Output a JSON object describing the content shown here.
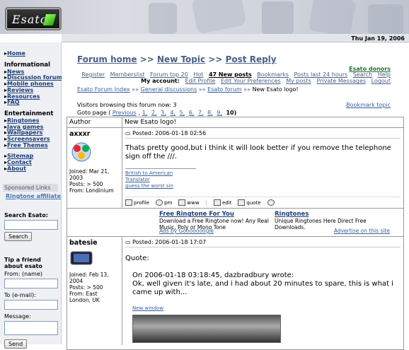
{
  "brand": {
    "logo_text": "Esato"
  },
  "date": "Thu Jan 19, 2006",
  "sidebar": {
    "home": "Home",
    "informational_heading": "Informational",
    "informational": [
      "News",
      "Discussion forum",
      "Mobile phones",
      "Reviews",
      "Resources",
      "FAQ"
    ],
    "entertainment_heading": "Entertainment",
    "entertainment": [
      "Ringtones",
      "Java games",
      "Wallpapers",
      "Screensavers",
      "Free Themes"
    ],
    "misc": [
      "Sitemap",
      "Contact",
      "About"
    ],
    "sponsored": "Sponsored Links",
    "ringtone_affiliate": "Ringtone affiliate",
    "search_label": "Search Esato:",
    "search_button": "Search",
    "tip_heading": "Tip a friend about esato",
    "from_label": "From: (name)",
    "to_label": "To (e-mail):",
    "message_label": "Message:",
    "send_button": "Send"
  },
  "breadcrumb_big": {
    "forum_home": "Forum home",
    "sep": ">>",
    "new_topic": "New Topic",
    "post_reply": "Post Reply"
  },
  "donors": "Esato donors",
  "navlinks": {
    "row1": [
      "Register",
      "Memberslist",
      "Forum top 20",
      "Hot",
      "47 New posts",
      "Bookmarks",
      "Posts last 24 hours",
      "Search",
      "Help"
    ],
    "row2_prefix": "My account:",
    "row2": [
      "Edit Profile",
      "Edit Your Preferences",
      "My posts",
      "Private Messages",
      "Logout"
    ]
  },
  "index_trail": {
    "forum_index": "Esato Forum Index",
    "general": "General discussions",
    "esato_forum": "Esato forum",
    "topic": "New Esato logo!",
    "sep": "»"
  },
  "visitors": "Visitors browsing this forum now: 3",
  "bookmark": "Bookmark topic",
  "goto": {
    "label": "Goto page (",
    "previous": "Previous",
    "pages": [
      "1,",
      "2,",
      "3,",
      "4,",
      "5,",
      "6,",
      "7,",
      "8,",
      "9,"
    ],
    "current": "10)"
  },
  "table": {
    "author_header": "Author",
    "topic_header": "New Esato logo!"
  },
  "post1": {
    "user": "axxxr",
    "joined": "Joined: Mar 21, 2003",
    "posts": "Posts: > 500",
    "from": "From: Londinium",
    "posted": "Posted: 2006-01-18 02:56",
    "text": "Thats pretty good,but i think it will look better if you remove the telephone sign off the ///.",
    "sig1": "British to American Translator",
    "sig2": "guess the worst sin",
    "actions": [
      "profile",
      "pm",
      "www",
      "edit",
      "quote"
    ]
  },
  "ads": {
    "ad1_title": "Free Ringtone For You",
    "ad1_text": "Download a Free Ringtone now! Any Real Music, Poly or Mono Tone",
    "ad2_title": "Ringtones",
    "ad2_text": "Unique Ringtones Here Direct Free Downloads.",
    "by": "Ads by Gooooooogle",
    "advertise": "Advertise on this site"
  },
  "post2": {
    "user": "batesie",
    "joined": "Joined: Feb 13, 2004",
    "posts": "Posts: > 500",
    "from": "From: East London, UK",
    "posted": "Posted: 2006-01-18 17:07",
    "quote_label": "Quote:",
    "quote_line1": "On 2006-01-18 03:18:45, dazbradbury wrote:",
    "quote_line2": "Ok, well given it's late, and i had about 20 minutes to spare, this is what i came up with...",
    "new_window": "New window"
  },
  "colors": {
    "link": "#38609a",
    "sidebar_bg": "#eef0f4",
    "donors": "#2a6e3a"
  }
}
